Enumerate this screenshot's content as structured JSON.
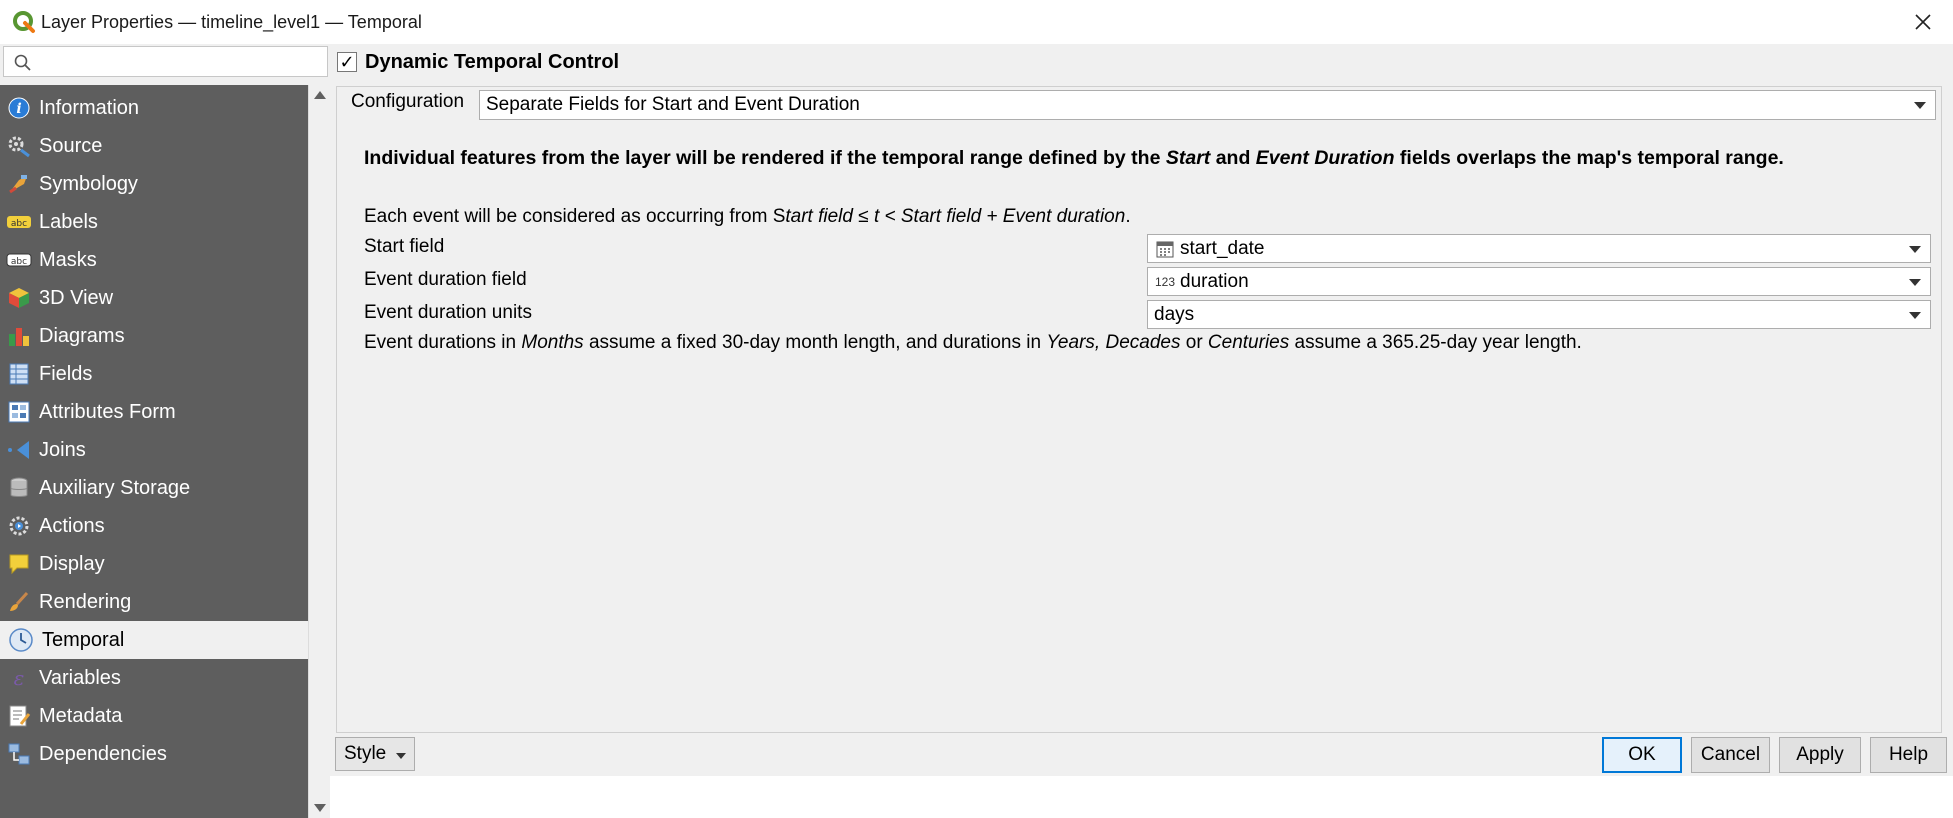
{
  "window": {
    "title": "Layer Properties — timeline_level1 — Temporal"
  },
  "search": {
    "placeholder": "",
    "value": ""
  },
  "sidebar": {
    "items": [
      {
        "label": "Information",
        "icon": "info-icon"
      },
      {
        "label": "Source",
        "icon": "source-icon"
      },
      {
        "label": "Symbology",
        "icon": "symbology-icon"
      },
      {
        "label": "Labels",
        "icon": "labels-icon"
      },
      {
        "label": "Masks",
        "icon": "masks-icon"
      },
      {
        "label": "3D View",
        "icon": "cube-icon"
      },
      {
        "label": "Diagrams",
        "icon": "diagrams-icon"
      },
      {
        "label": "Fields",
        "icon": "fields-icon"
      },
      {
        "label": "Attributes Form",
        "icon": "form-icon"
      },
      {
        "label": "Joins",
        "icon": "joins-icon"
      },
      {
        "label": "Auxiliary Storage",
        "icon": "storage-icon"
      },
      {
        "label": "Actions",
        "icon": "actions-icon"
      },
      {
        "label": "Display",
        "icon": "display-icon"
      },
      {
        "label": "Rendering",
        "icon": "brush-icon"
      },
      {
        "label": "Temporal",
        "icon": "clock-icon",
        "active": true
      },
      {
        "label": "Variables",
        "icon": "variables-icon"
      },
      {
        "label": "Metadata",
        "icon": "metadata-icon"
      },
      {
        "label": "Dependencies",
        "icon": "dependencies-icon"
      }
    ]
  },
  "temporal": {
    "group_title": "Dynamic Temporal Control",
    "enabled": true,
    "configuration_label": "Configuration",
    "configuration_value": "Separate Fields for Start and Event Duration",
    "description": {
      "p1": "Individual features from the layer will be rendered if the temporal range defined by the ",
      "start": "Start",
      "and": " and ",
      "event_duration": "Event Duration",
      "p2": " fields overlaps the map's temporal range."
    },
    "event_line": {
      "p1": "Each event will be considered as occurring from S",
      "italic": "tart field ≤ t < Start field + Event duration",
      "p2": "."
    },
    "start_field_label": "Start field",
    "start_field_value": "start_date",
    "duration_field_label": "Event duration field",
    "duration_field_value": "duration",
    "duration_field_icon_text": "123",
    "duration_units_label": "Event duration units",
    "duration_units_value": "days",
    "note": {
      "p1": "Event durations in ",
      "months": "Months",
      "p2": " assume a fixed 30-day month length, and durations in ",
      "years": "Years,",
      "space1": " ",
      "decades": "Decades",
      "p3": " or ",
      "centuries": "Centuries",
      "p4": " assume a 365.25-day year length."
    }
  },
  "buttons": {
    "style": "Style",
    "ok": "OK",
    "cancel": "Cancel",
    "apply": "Apply",
    "help": "Help"
  },
  "colors": {
    "sidebar_bg": "#5e5e5e",
    "panel_bg": "#f0f0f0",
    "accent": "#0078d7"
  }
}
